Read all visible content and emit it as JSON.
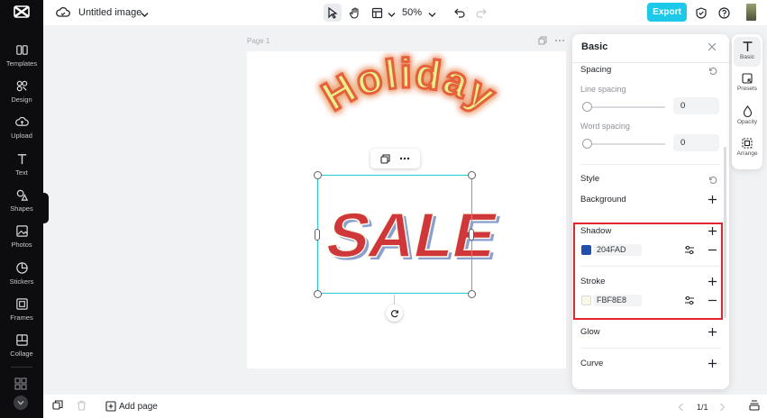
{
  "app": {
    "logo_icon": "capcut-logo-icon",
    "document_title": "Untitled image"
  },
  "sidebar": {
    "items": [
      {
        "label": "Templates",
        "icon": "templates-icon"
      },
      {
        "label": "Design",
        "icon": "design-icon"
      },
      {
        "label": "Upload",
        "icon": "upload-icon"
      },
      {
        "label": "Text",
        "icon": "text-icon"
      },
      {
        "label": "Shapes",
        "icon": "shapes-icon"
      },
      {
        "label": "Photos",
        "icon": "photos-icon"
      },
      {
        "label": "Stickers",
        "icon": "stickers-icon"
      },
      {
        "label": "Frames",
        "icon": "frames-icon"
      },
      {
        "label": "Collage",
        "icon": "collage-icon"
      }
    ]
  },
  "toolbar": {
    "zoom_level": "50%",
    "export_label": "Export"
  },
  "canvas": {
    "page_label": "Page 1",
    "text_top": "Holiday",
    "text_main": "SALE"
  },
  "panel": {
    "title": "Basic",
    "spacing_label": "Spacing",
    "line_spacing_label": "Line spacing",
    "line_spacing_value": "0",
    "word_spacing_label": "Word spacing",
    "word_spacing_value": "0",
    "style_label": "Style",
    "background_label": "Background",
    "shadow_label": "Shadow",
    "shadow_color_hex": "204FAD",
    "shadow_color": "#204FAD",
    "stroke_label": "Stroke",
    "stroke_color_hex": "FBF8E8",
    "stroke_color": "#FBF8E8",
    "glow_label": "Glow",
    "curve_label": "Curve"
  },
  "rail": {
    "items": [
      {
        "label": "Basic",
        "icon": "text-t-icon",
        "active": true
      },
      {
        "label": "Presets",
        "icon": "presets-icon"
      },
      {
        "label": "Opacity",
        "icon": "opacity-icon"
      },
      {
        "label": "Arrange",
        "icon": "arrange-icon"
      }
    ]
  },
  "bottombar": {
    "add_page_label": "Add page",
    "page_counter": "1/1"
  },
  "colors": {
    "accent": "#1ec8e8",
    "selection": "#28c7d4",
    "highlight": "#e3262e"
  }
}
